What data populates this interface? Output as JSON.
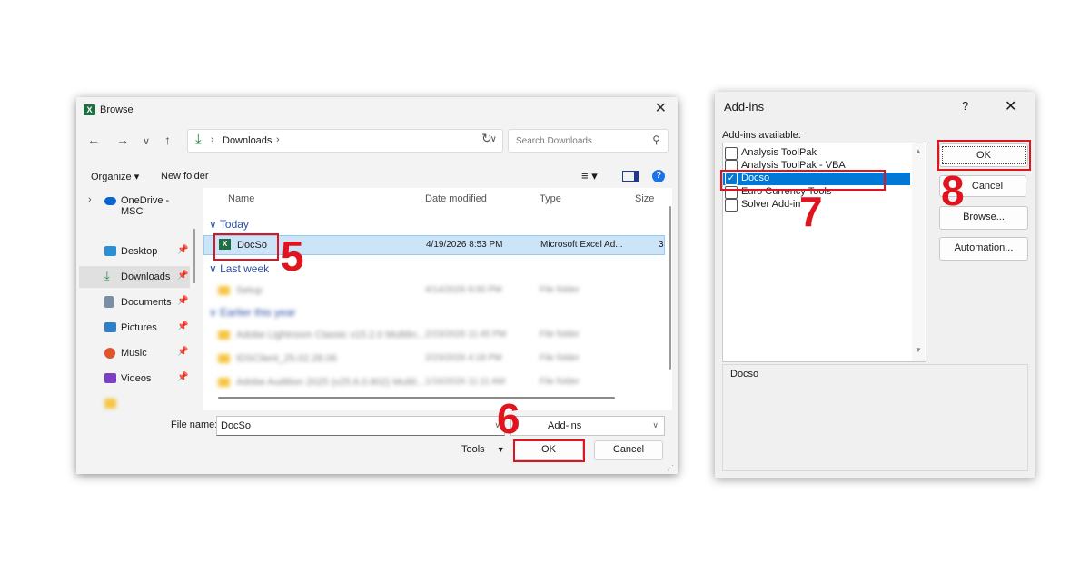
{
  "browse": {
    "title": "Browse",
    "close_icon": "close-icon",
    "address": {
      "path": "Downloads"
    },
    "search": {
      "placeholder": "Search Downloads"
    },
    "commands": {
      "organize": "Organize ▾",
      "new_folder": "New folder"
    },
    "nav": [
      {
        "label": "OneDrive - MSC",
        "icon": "onedrive-icon"
      },
      {
        "label": "Desktop",
        "icon": "desktop-icon"
      },
      {
        "label": "Downloads",
        "icon": "downloads-icon"
      },
      {
        "label": "Documents",
        "icon": "documents-icon"
      },
      {
        "label": "Pictures",
        "icon": "pictures-icon"
      },
      {
        "label": "Music",
        "icon": "music-icon"
      },
      {
        "label": "Videos",
        "icon": "videos-icon"
      }
    ],
    "columns": {
      "name": "Name",
      "date": "Date modified",
      "type": "Type",
      "size": "Size"
    },
    "groups": {
      "today": "Today",
      "last_week": "Last week",
      "earlier": "Earlier this year"
    },
    "selected_file": {
      "name": "DocSo",
      "date": "4/19/2026 8:53 PM",
      "type": "Microsoft Excel Ad...",
      "size": "3"
    },
    "blurred_rows": [
      {
        "name": "Setup",
        "date": "4/14/2026 9:00 PM",
        "type": "File folder"
      },
      {
        "name": "Adobe Lightroom Classic v15.2.0 Multilin...",
        "date": "2/23/2026 11:45 PM",
        "type": "File folder"
      },
      {
        "name": "IDSClient_25.02.28.06",
        "date": "2/23/2026 4:18 PM",
        "type": "File folder"
      },
      {
        "name": "Adobe Audition 2025 (v25.6.0.802) Multil...",
        "date": "1/16/2026 11:11 AM",
        "type": "File folder"
      }
    ],
    "file_name_label": "File name:",
    "file_name_value": "DocSo",
    "file_type_value": "Add-ins",
    "tools_label": "Tools",
    "ok_label": "OK",
    "cancel_label": "Cancel"
  },
  "addins": {
    "title": "Add-ins",
    "help": "?",
    "available_label": "Add-ins available:",
    "items": [
      {
        "label": "Analysis ToolPak",
        "checked": false
      },
      {
        "label": "Analysis ToolPak - VBA",
        "checked": false
      },
      {
        "label": "Docso",
        "checked": true
      },
      {
        "label": "Euro Currency Tools",
        "checked": false
      },
      {
        "label": "Solver Add-in",
        "checked": false
      }
    ],
    "description": "Docso",
    "ok_label": "OK",
    "cancel_label": "Cancel",
    "browse_label": "Browse...",
    "automation_label": "Automation..."
  },
  "steps": [
    "5",
    "6",
    "7",
    "8"
  ],
  "colors": {
    "callout": "#e0141e",
    "selection": "#0078d7",
    "excel_green": "#1d6f42"
  }
}
